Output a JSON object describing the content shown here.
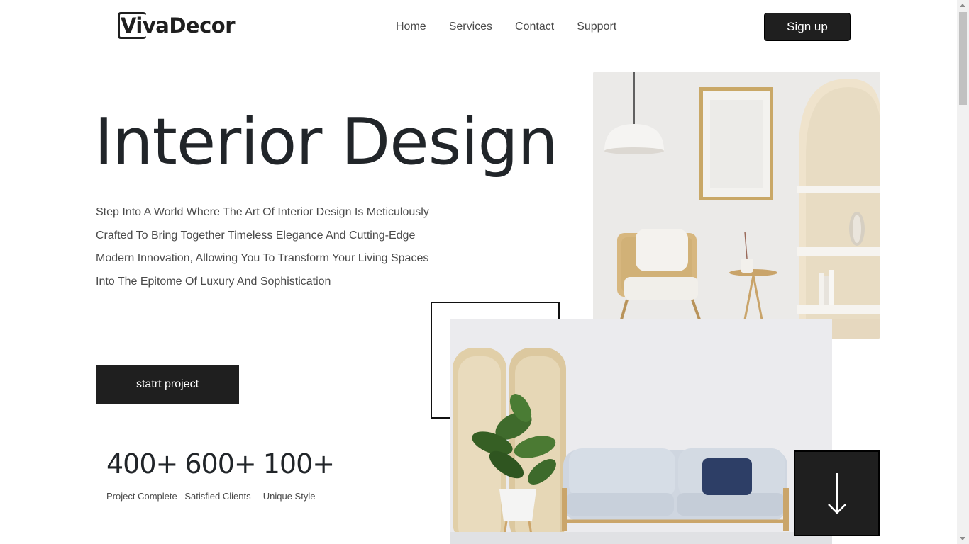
{
  "header": {
    "logo_text": "VivaDecor",
    "nav": [
      "Home",
      "Services",
      "Contact",
      "Support"
    ],
    "signup_label": "Sign up"
  },
  "hero": {
    "title": "Interior Design",
    "description_lines": [
      "Step Into A World Where The Art Of Interior Design Is Meticulously",
      "Crafted To Bring Together Timeless Elegance And Cutting-Edge",
      "Modern Innovation, Allowing You To Transform Your Living Spaces",
      "Into The Epitome Of Luxury And Sophistication"
    ],
    "cta_label": "statrt project"
  },
  "stats": [
    {
      "value": "400+",
      "label": "Project Complete"
    },
    {
      "value": "600+",
      "label": "Satisfied Clients"
    },
    {
      "value": "100+",
      "label": "Unique Style"
    }
  ],
  "scroll_button": {
    "icon": "arrow-down-icon"
  },
  "colors": {
    "primary_dark": "#1f1f1f",
    "text": "#212529",
    "muted_text": "#4a4a4a",
    "background": "#ffffff"
  }
}
